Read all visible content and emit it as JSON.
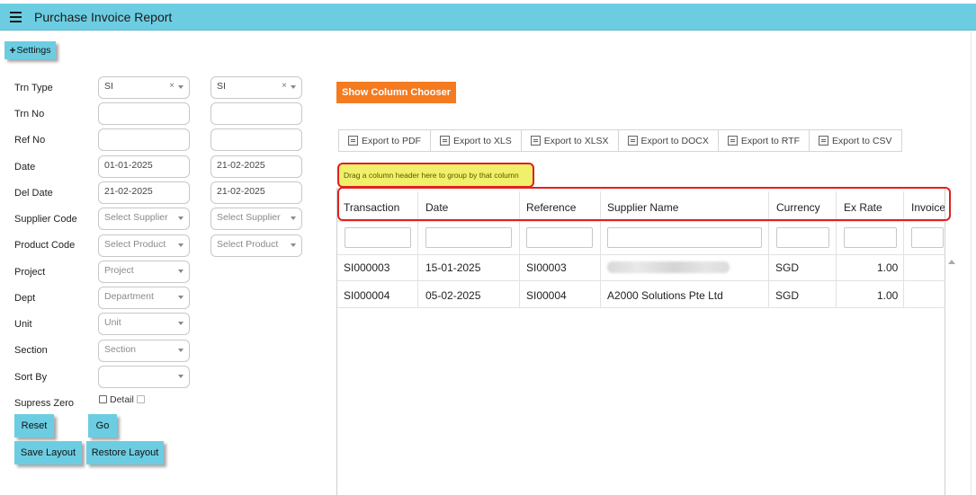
{
  "header": {
    "title": "Purchase Invoice Report",
    "menu_icon": "hamburger-icon"
  },
  "settings": {
    "plus": "+",
    "label": "Settings"
  },
  "form": {
    "labels": {
      "trn_type": "Trn Type",
      "trn_no": "Trn No",
      "ref_no": "Ref No",
      "date": "Date",
      "del_date": "Del Date",
      "supplier_code": "Supplier Code",
      "product_code": "Product Code",
      "project": "Project",
      "dept": "Dept",
      "unit": "Unit",
      "section": "Section",
      "sort_by": "Sort By",
      "supress_zero": "Supress Zero"
    },
    "trn_type_from": "SI",
    "trn_type_to": "SI",
    "clear_glyph": "×",
    "trn_no_from": "",
    "trn_no_to": "",
    "ref_no_from": "",
    "ref_no_to": "",
    "date_from": "01-01-2025",
    "date_to": "21-02-2025",
    "del_date_from": "21-02-2025",
    "del_date_to": "21-02-2025",
    "supplier_placeholder": "Select Supplier",
    "product_placeholder": "Select Product",
    "project_placeholder": "Project",
    "dept_placeholder": "Department",
    "unit_placeholder": "Unit",
    "section_placeholder": "Section",
    "sort_by": "",
    "supress_zero_checked": false,
    "detail_label": "Detail",
    "detail_checked": false
  },
  "actions": {
    "reset": "Reset",
    "go": "Go",
    "save_layout": "Save Layout",
    "restore_layout": "Restore Layout"
  },
  "chooser_label": "Show Column Chooser",
  "exports": [
    "Export to PDF",
    "Export to XLS",
    "Export to XLSX",
    "Export to DOCX",
    "Export to RTF",
    "Export to CSV"
  ],
  "group_panel_text": "Drag a column header here to group by that column",
  "grid": {
    "columns": [
      "Transaction",
      "Date",
      "Reference",
      "Supplier Name",
      "Currency",
      "Ex Rate",
      "Invoice"
    ],
    "rows": [
      {
        "transaction": "SI000003",
        "date": "15-01-2025",
        "reference": "SI00003",
        "supplier": "",
        "currency": "SGD",
        "ex_rate": "1.00"
      },
      {
        "transaction": "SI000004",
        "date": "05-02-2025",
        "reference": "SI00004",
        "supplier": "A2000 Solutions Pte Ltd",
        "currency": "SGD",
        "ex_rate": "1.00"
      }
    ]
  },
  "colors": {
    "header_bg": "#6ccde2",
    "accent_orange": "#f47b20",
    "group_panel_bg": "#f0f06a",
    "highlight_red": "#e02020"
  }
}
